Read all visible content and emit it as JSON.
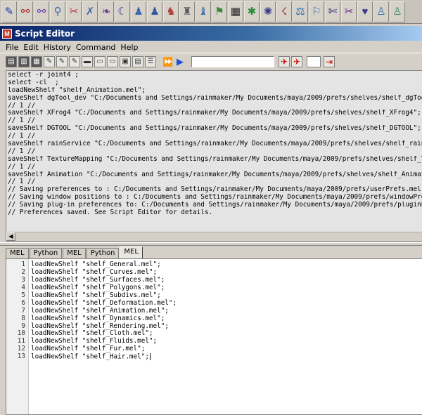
{
  "shelf": {
    "icons": [
      {
        "glyph": "✎",
        "color": "#1a3aa8",
        "name": "lasso-tool-icon"
      },
      {
        "glyph": "⚯",
        "color": "#b02020",
        "name": "joint-chain-icon"
      },
      {
        "glyph": "⚯",
        "color": "#6a3aa8",
        "name": "ik-handle-icon"
      },
      {
        "glyph": "⚲",
        "color": "#3a6ab0",
        "name": "locator-icon"
      },
      {
        "glyph": "✂",
        "color": "#b03a3a",
        "name": "ik-spline-icon"
      },
      {
        "glyph": "✗",
        "color": "#3a6aa8",
        "name": "cross-joint-icon"
      },
      {
        "glyph": "❧",
        "color": "#6a3a8a",
        "name": "curve-icon"
      },
      {
        "glyph": "☾",
        "color": "#3a3aa8",
        "name": "bend-icon"
      },
      {
        "glyph": "♟",
        "color": "#3a6ab0",
        "name": "skeleton-icon"
      },
      {
        "glyph": "♟",
        "color": "#2a5aa0",
        "name": "bind-skin-icon"
      },
      {
        "glyph": "♞",
        "color": "#b03a3a",
        "name": "rig-icon"
      },
      {
        "glyph": "♜",
        "color": "#5a5a5a",
        "name": "smooth-bind-icon"
      },
      {
        "glyph": "♝",
        "color": "#3a6ab0",
        "name": "rigid-bind-icon"
      },
      {
        "glyph": "⚑",
        "color": "#3a8a3a",
        "name": "paint-weights-icon"
      },
      {
        "glyph": "▦",
        "color": "#222222",
        "name": "checker-icon"
      },
      {
        "glyph": "✱",
        "color": "#2a8a3a",
        "name": "star-icon"
      },
      {
        "glyph": "✺",
        "color": "#3a3a8a",
        "name": "cluster-icon"
      },
      {
        "glyph": "☇",
        "color": "#a02a2a",
        "name": "deform-icon"
      },
      {
        "glyph": "⚖",
        "color": "#2a6aa0",
        "name": "constraint-icon"
      },
      {
        "glyph": "⚐",
        "color": "#3a6ab0",
        "name": "flag-icon"
      },
      {
        "glyph": "✄",
        "color": "#2a2a7a",
        "name": "cut-icon"
      },
      {
        "glyph": "✂",
        "color": "#6a2a8a",
        "name": "scissors-icon"
      },
      {
        "glyph": "♥",
        "color": "#3a3a8a",
        "name": "heart-icon"
      },
      {
        "glyph": "♙",
        "color": "#3a6ab0",
        "name": "figure-icon"
      },
      {
        "glyph": "♙",
        "color": "#3a8a6a",
        "name": "figure-pose-icon"
      }
    ]
  },
  "window": {
    "title": "Script Editor",
    "app_icon_letter": "M"
  },
  "menu": {
    "items": [
      "File",
      "Edit",
      "History",
      "Command",
      "Help"
    ]
  },
  "toolbar": {
    "search_value": ""
  },
  "history": {
    "lines": [
      "select -r joint4 ;",
      "select -cl  ;",
      "loadNewShelf \"shelf_Animation.mel\";",
      "saveShelf dgTool_dev \"C:/Documents and Settings/rainmaker/My Documents/maya/2009/prefs/shelves/shelf_dgTool_",
      "// 1 //",
      "saveShelf XFrog4 \"C:/Documents and Settings/rainmaker/My Documents/maya/2009/prefs/shelves/shelf_XFrog4\";",
      "// 1 //",
      "saveShelf DGTOOL \"C:/Documents and Settings/rainmaker/My Documents/maya/2009/prefs/shelves/shelf_DGTOOL\";",
      "// 1 //",
      "saveShelf rainService \"C:/Documents and Settings/rainmaker/My Documents/maya/2009/prefs/shelves/shelf_rainSe",
      "// 1 //",
      "saveShelf TextureMapping \"C:/Documents and Settings/rainmaker/My Documents/maya/2009/prefs/shelves/shelf_Tex",
      "// 1 //",
      "saveShelf Animation \"C:/Documents and Settings/rainmaker/My Documents/maya/2009/prefs/shelves/shelf_Animati",
      "// 1 //",
      "// Saving preferences to : C:/Documents and Settings/rainmaker/My Documents/maya/2009/prefs/userPrefs.mel",
      "// Saving window positions to : C:/Documents and Settings/rainmaker/My Documents/maya/2009/prefs/windowPrefs",
      "// Saving plug-in preferences to: C:/Documents and Settings/rainmaker/My Documents/maya/2009/prefs/pluginPre",
      "// Preferences saved. See Script Editor for details."
    ]
  },
  "tabs": [
    {
      "label": "MEL",
      "active": false
    },
    {
      "label": "Python",
      "active": false
    },
    {
      "label": "MEL",
      "active": false
    },
    {
      "label": "Python",
      "active": false
    },
    {
      "label": "MEL",
      "active": true
    }
  ],
  "editor": {
    "lines": [
      {
        "n": "1",
        "code": "loadNewShelf \"shelf_General.mel\";"
      },
      {
        "n": "2",
        "code": "loadNewShelf \"shelf_Curves.mel\";"
      },
      {
        "n": "3",
        "code": "loadNewShelf \"shelf_Surfaces.mel\";"
      },
      {
        "n": "4",
        "code": "loadNewShelf \"shelf_Polygons.mel\";"
      },
      {
        "n": "5",
        "code": "loadNewShelf \"shelf_Subdivs.mel\";"
      },
      {
        "n": "6",
        "code": "loadNewShelf \"shelf_Deformation.mel\";"
      },
      {
        "n": "7",
        "code": "loadNewShelf \"shelf_Animation.mel\";"
      },
      {
        "n": "8",
        "code": "loadNewShelf \"shelf_Dynamics.mel\";"
      },
      {
        "n": "9",
        "code": "loadNewShelf \"shelf_Rendering.mel\";"
      },
      {
        "n": "10",
        "code": "loadNewShelf \"shelf_Cloth.mel\";"
      },
      {
        "n": "11",
        "code": "loadNewShelf \"shelf_Fluids.mel\";"
      },
      {
        "n": "12",
        "code": "loadNewShelf \"shelf_Fur.mel\";"
      },
      {
        "n": "13",
        "code": "loadNewShelf \"shelf_Hair.mel\";"
      }
    ]
  }
}
